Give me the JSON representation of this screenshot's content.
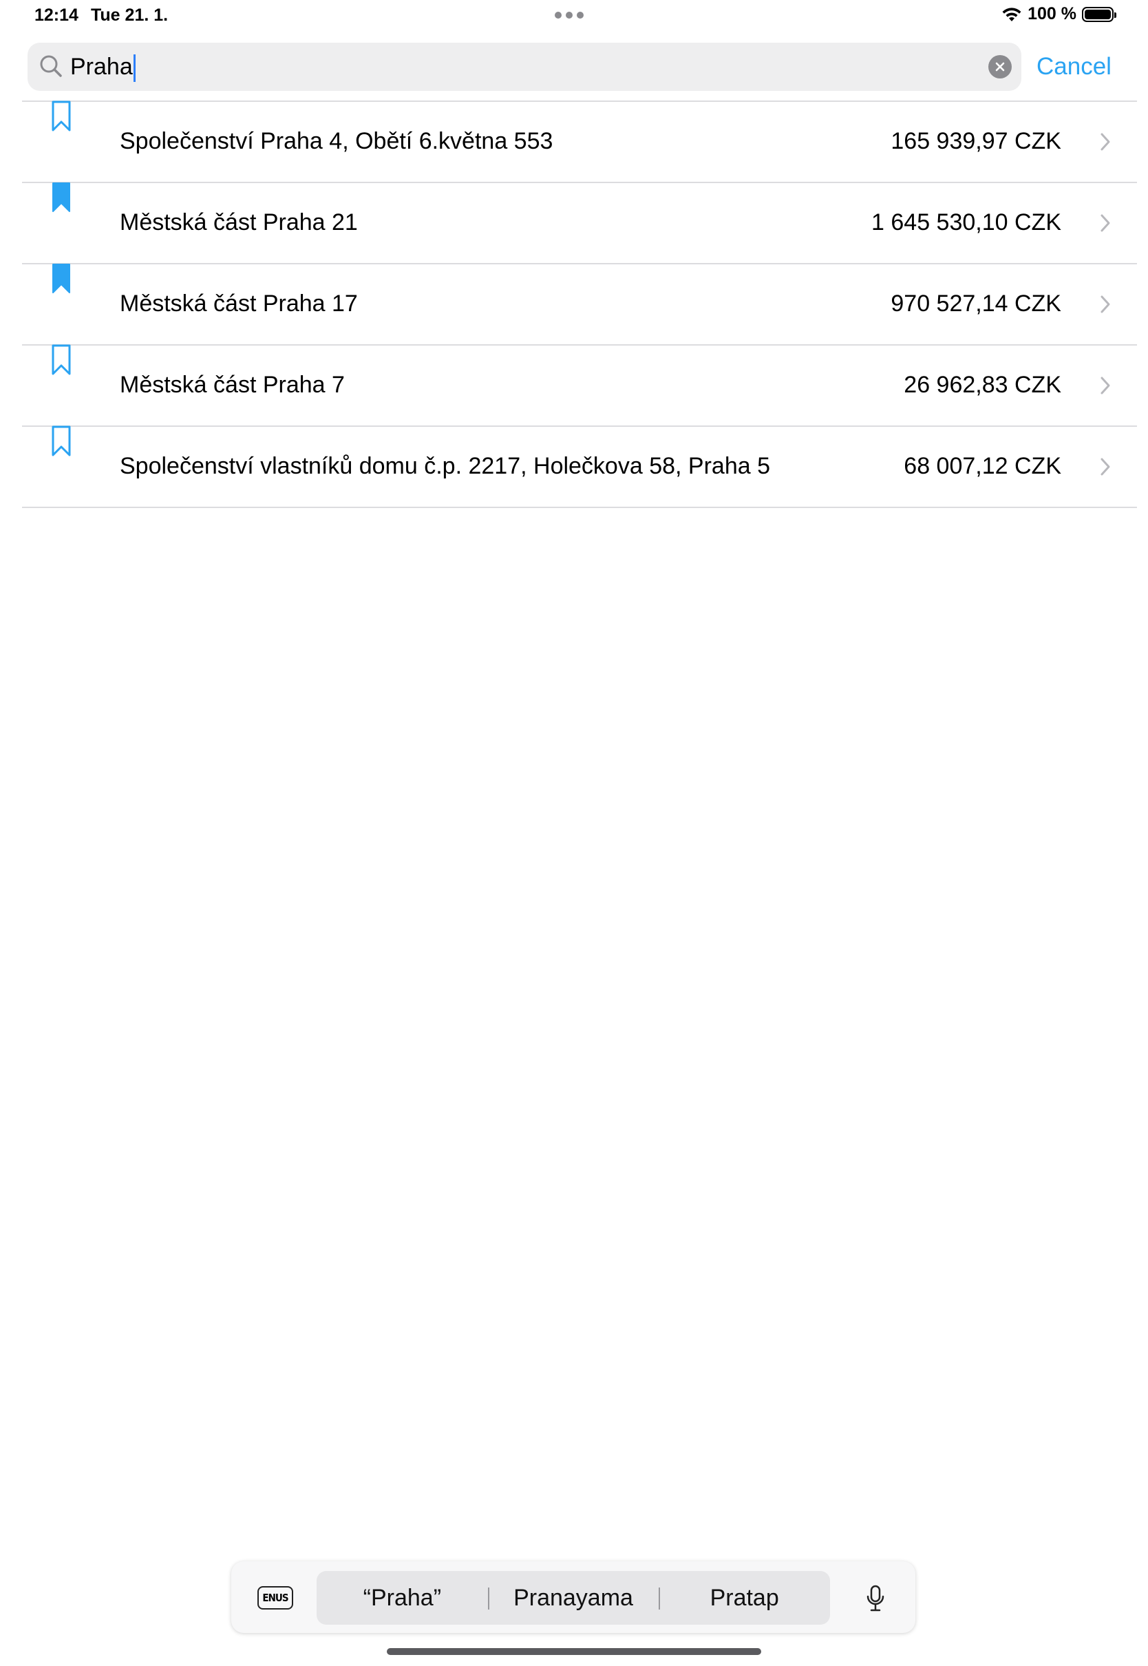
{
  "status_bar": {
    "time": "12:14",
    "date": "Tue 21. 1.",
    "battery_percent": "100 %"
  },
  "search": {
    "value": "Praha",
    "cancel_label": "Cancel"
  },
  "results": [
    {
      "title": "Společenství Praha 4, Obětí 6.května 553",
      "amount": "165 939,97 CZK",
      "bookmarked": false
    },
    {
      "title": "Městská část Praha 21",
      "amount": "1 645 530,10 CZK",
      "bookmarked": true
    },
    {
      "title": "Městská část Praha 17",
      "amount": "970 527,14 CZK",
      "bookmarked": true
    },
    {
      "title": "Městská část Praha 7",
      "amount": "26 962,83 CZK",
      "bookmarked": false
    },
    {
      "title": "Společenství vlastníků domu č.p. 2217, Holečkova 58, Praha 5",
      "amount": "68 007,12 CZK",
      "bookmarked": false
    }
  ],
  "keyboard_bar": {
    "language_key": "ENUS",
    "suggestions": [
      "“Praha”",
      "Pranayama",
      "Pratap"
    ]
  },
  "colors": {
    "accent": "#2aa3f2",
    "bookmark": "#2aa3f2",
    "separator": "#dcdcdf",
    "search_background": "#eeeeef"
  }
}
